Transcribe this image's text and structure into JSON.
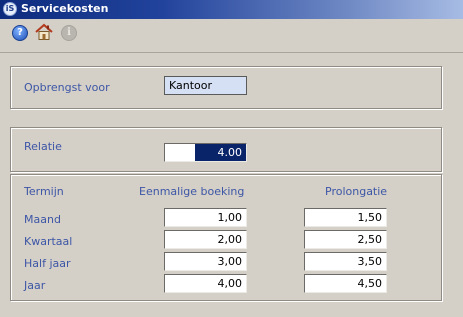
{
  "window": {
    "title": "Servicekosten",
    "app_icon_label": "iS"
  },
  "toolbar": {
    "help": {
      "icon": "help-icon",
      "glyph": "?"
    },
    "home": {
      "icon": "home-icon"
    },
    "info": {
      "icon": "info-icon",
      "glyph": "i",
      "disabled": true
    }
  },
  "opbrengst": {
    "label": "Opbrengst voor",
    "value": "Kantoor"
  },
  "relatie": {
    "label": "Relatie",
    "value": "4.00"
  },
  "table": {
    "headers": {
      "termijn": "Termijn",
      "eenmalig": "Eenmalige boeking",
      "prolongatie": "Prolongatie"
    },
    "rows": [
      {
        "label": "Maand",
        "eenmalig": "1,00",
        "prolongatie": "1,50"
      },
      {
        "label": "Kwartaal",
        "eenmalig": "2,00",
        "prolongatie": "2,50"
      },
      {
        "label": "Half jaar",
        "eenmalig": "3,00",
        "prolongatie": "3,50"
      },
      {
        "label": "Jaar",
        "eenmalig": "4,00",
        "prolongatie": "4,50"
      }
    ]
  },
  "colors": {
    "label_blue": "#3d56a6",
    "selection": "#0a246a",
    "field_highlight": "#d6e0f4"
  }
}
